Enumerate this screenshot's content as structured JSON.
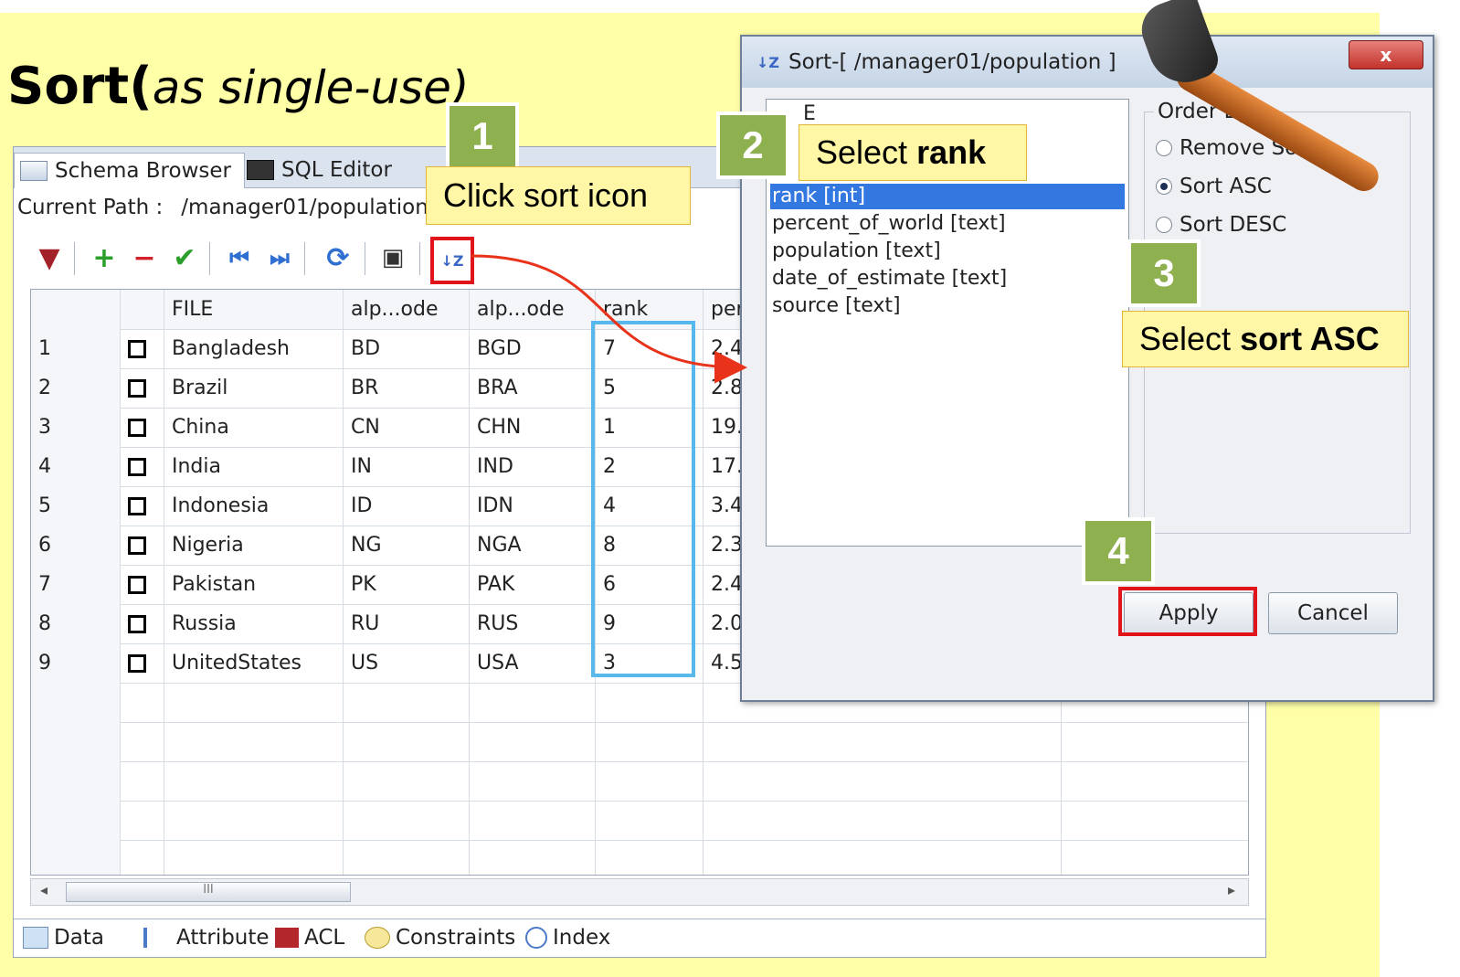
{
  "slide": {
    "title_main": "Sort(",
    "title_italic": "as single-use)"
  },
  "window": {
    "tabs": [
      "Schema Browser",
      "SQL Editor"
    ],
    "path_label": "Current Path :",
    "path_value": "/manager01/population",
    "toolbar_icons": [
      "filter-icon",
      "add-row-icon",
      "delete-row-icon",
      "commit-check-icon",
      "first-record-icon",
      "last-record-icon",
      "refresh-icon",
      "save-icon",
      "sort-icon"
    ]
  },
  "grid": {
    "columns": [
      "FILE",
      "alp...ode",
      "alp...ode",
      "rank",
      "per"
    ],
    "rows": [
      {
        "n": "1",
        "file": "Bangladesh",
        "a2": "BD",
        "a3": "BGD",
        "rank": "7",
        "per": "2.4"
      },
      {
        "n": "2",
        "file": "Brazil",
        "a2": "BR",
        "a3": "BRA",
        "rank": "5",
        "per": "2.8"
      },
      {
        "n": "3",
        "file": "China",
        "a2": "CN",
        "a3": "CHN",
        "rank": "1",
        "per": "19."
      },
      {
        "n": "4",
        "file": "India",
        "a2": "IN",
        "a3": "IND",
        "rank": "2",
        "per": "17."
      },
      {
        "n": "5",
        "file": "Indonesia",
        "a2": "ID",
        "a3": "IDN",
        "rank": "4",
        "per": "3.4"
      },
      {
        "n": "6",
        "file": "Nigeria",
        "a2": "NG",
        "a3": "NGA",
        "rank": "8",
        "per": "2.3"
      },
      {
        "n": "7",
        "file": "Pakistan",
        "a2": "PK",
        "a3": "PAK",
        "rank": "6",
        "per": "2.4"
      },
      {
        "n": "8",
        "file": "Russia",
        "a2": "RU",
        "a3": "RUS",
        "rank": "9",
        "per": "2.0"
      },
      {
        "n": "9",
        "file": "UnitedStates",
        "a2": "US",
        "a3": "USA",
        "rank": "3",
        "per": "4.5"
      }
    ],
    "scroll_thumb": "III"
  },
  "bottom_tabs": [
    "Data",
    "Attribute",
    "ACL",
    "Constraints",
    "Index"
  ],
  "dialog": {
    "title": "Sort-[ /manager01/population ]",
    "close": "x",
    "columns_partial": "E",
    "columns": [
      "rank [int]",
      "percent_of_world [text]",
      "population [text]",
      "date_of_estimate [text]",
      "source [text]"
    ],
    "order_by_label": "Order By",
    "options": [
      "Remove Sort",
      "Sort ASC",
      "Sort DESC"
    ],
    "selected_option": "Sort ASC",
    "apply": "Apply",
    "cancel": "Cancel"
  },
  "callouts": {
    "step1_num": "1",
    "step1_text": "Click sort icon",
    "step2_num": "2",
    "step2_text": "Select",
    "step2_bold": "rank",
    "step3_num": "3",
    "step3_text": "Select",
    "step3_bold": "sort ASC",
    "step4_num": "4"
  },
  "colors": {
    "slide_bg": "#ffffa8",
    "callout_green": "#8fb04e",
    "highlight_red": "#e0141a",
    "highlight_blue": "#58b8ec"
  }
}
